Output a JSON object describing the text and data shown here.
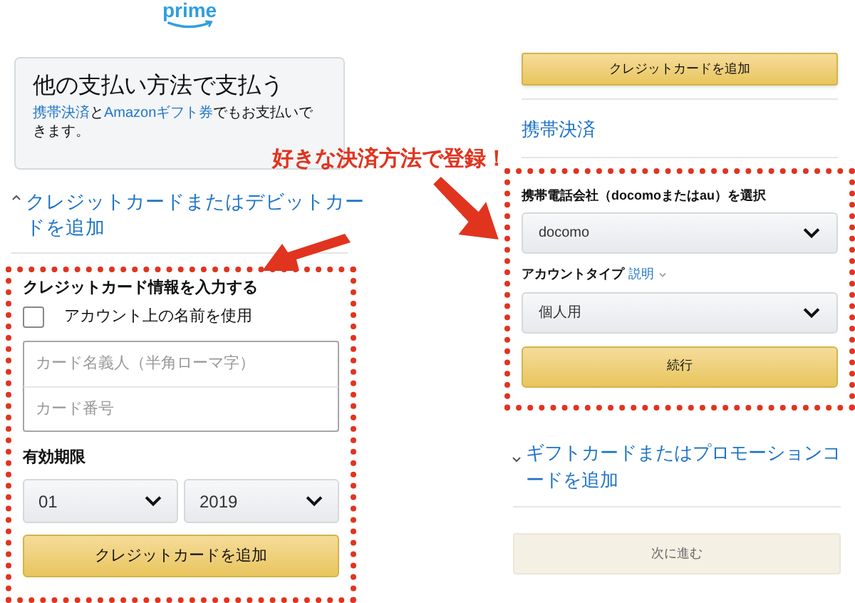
{
  "left_panel": {
    "logo": "prime",
    "other_payment_box": {
      "title": "他の支払い方法で支払う",
      "description": [
        {
          "text": "携帯決済",
          "kind": "link"
        },
        {
          "text": "と",
          "kind": "text"
        },
        {
          "text": "Amazonギフト券",
          "kind": "link"
        },
        {
          "text": "でもお支払いできます。",
          "kind": "text"
        }
      ]
    },
    "card_section": {
      "label": "クレジットカードまたはデビットカードを追加",
      "expanded": true
    },
    "card_form": {
      "heading": "クレジットカード情報を入力する",
      "use_account_name": {
        "label": "アカウント上の名前を使用",
        "checked": false
      },
      "fields": [
        {
          "placeholder": "カード名義人（半角ローマ字）"
        },
        {
          "placeholder": "カード番号"
        }
      ],
      "expiry_label": "有効期限",
      "month": "01",
      "year": "2019",
      "button": "クレジットカードを追加"
    }
  },
  "right_panel": {
    "top_button": "クレジットカードを追加",
    "mobile_section": {
      "label": "携帯決済"
    },
    "mobile_form": {
      "carrier_label": "携帯電話会社（docomoまたはau）を選択",
      "carrier": "docomo",
      "account_type_label": "アカウントタイプ",
      "help_link": "説明",
      "account_type": "個人用",
      "button": "続行"
    },
    "gift_section": {
      "label": "ギフトカードまたはプロモーションコードを追加",
      "expanded": false
    },
    "next_button": {
      "label": "次に進む",
      "disabled": true
    }
  },
  "annotation": {
    "text": "好きな決済方法で登録！"
  }
}
